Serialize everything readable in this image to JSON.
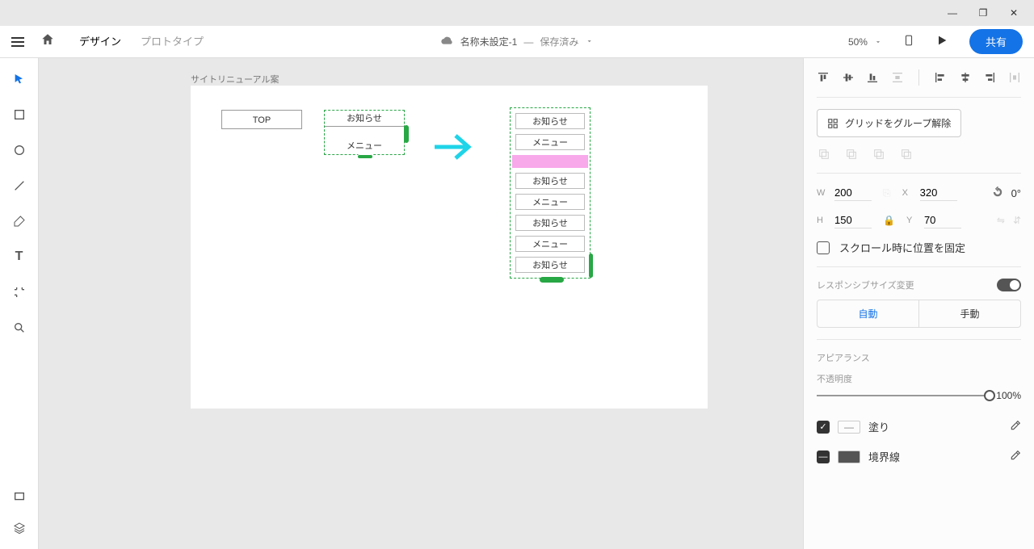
{
  "titlebar": {
    "minimize": "—",
    "maximize": "❐",
    "close": "✕"
  },
  "topbar": {
    "tabs": {
      "design": "デザイン",
      "prototype": "プロトタイプ"
    },
    "docname": "名称未設定-1",
    "docstatus": "保存済み",
    "zoom": "50%",
    "share": "共有"
  },
  "canvas": {
    "artboard_label": "サイトリニューアル案",
    "top_box": "TOP",
    "group_a": {
      "item1": "お知らせ",
      "item2": "メニュー"
    },
    "group_b": {
      "r1": "お知らせ",
      "r2": "メニュー",
      "r3": "お知らせ",
      "r4": "メニュー",
      "r5": "お知らせ",
      "r6": "メニュー",
      "r7": "お知らせ"
    }
  },
  "panel": {
    "ungroup_grid": "グリッドをグループ解除",
    "w_label": "W",
    "w": "200",
    "x_label": "X",
    "x": "320",
    "h_label": "H",
    "h": "150",
    "y_label": "Y",
    "y": "70",
    "rotate": "0°",
    "fix_scroll": "スクロール時に位置を固定",
    "responsive_title": "レスポンシブサイズ変更",
    "auto": "自動",
    "manual": "手動",
    "appearance_title": "アピアランス",
    "opacity_label": "不透明度",
    "opacity_value": "100%",
    "fill_label": "塗り",
    "border_label": "境界線",
    "fill_swatch_text": "—"
  }
}
